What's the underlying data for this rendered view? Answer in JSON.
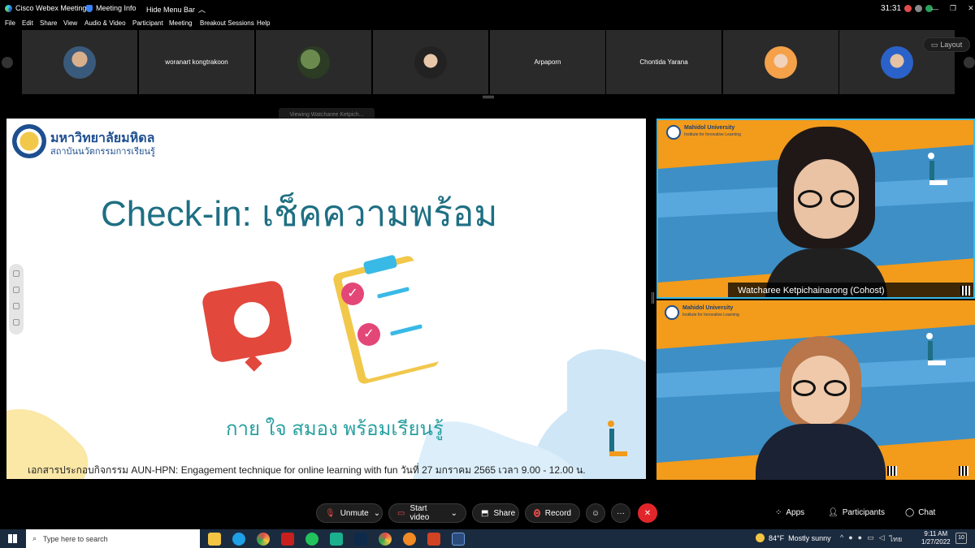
{
  "window": {
    "app_title": "Cisco Webex Meetings",
    "meeting_info": "Meeting Info",
    "hide_menu_bar": "Hide Menu Bar",
    "timer": "31:31"
  },
  "menu": [
    "File",
    "Edit",
    "Share",
    "View",
    "Audio & Video",
    "Participant",
    "Meeting",
    "Breakout Sessions",
    "Help"
  ],
  "participants_strip": [
    {
      "name": "",
      "type": "photo"
    },
    {
      "name": "woranart kongtrakoon",
      "type": "text"
    },
    {
      "name": "",
      "type": "photo"
    },
    {
      "name": "",
      "type": "photo"
    },
    {
      "name": "Arpaporn",
      "type": "text"
    },
    {
      "name": "Chontida Yarana",
      "type": "text"
    },
    {
      "name": "",
      "type": "photo"
    },
    {
      "name": "",
      "type": "photo"
    }
  ],
  "layout_button": "Layout",
  "viewing_label": "Viewing Watcharee Ketpich...",
  "slide": {
    "logo_line1": "มหาวิทยาลัยมหิดล",
    "logo_line2": "สถาบันนวัตกรรมการเรียนรู้",
    "title": "Check-in: เช็คความพร้อม",
    "subtitle": "กาย ใจ สมอง พร้อมเรียนรู้",
    "footer": "เอกสารประกอบกิจกรรม AUN-HPN: Engagement technique for online learning with fun วันที่ 27 มกราคม 2565 เวลา 9.00 - 12.00 น."
  },
  "videos": [
    {
      "name_label": "Watcharee Ketpichainarong (Cohost)",
      "bg_header": "Mahidol University",
      "bg_sub": "Institute for Innovative Learning"
    },
    {
      "name_label": "",
      "bg_header": "Mahidol University",
      "bg_sub": "Institute for Innovative Learning"
    }
  ],
  "toolbar": {
    "unmute": "Unmute",
    "start_video": "Start video",
    "share": "Share",
    "record": "Record",
    "apps": "Apps",
    "participants": "Participants",
    "chat": "Chat"
  },
  "taskbar": {
    "search_placeholder": "Type here to search",
    "weather_temp": "84°F",
    "weather_desc": "Mostly sunny",
    "lang": "ไทย",
    "time": "9:11 AM",
    "date": "1/27/2022",
    "notification_count": "10"
  },
  "colors": {
    "orange_bg": "#f39b1b",
    "active_border": "#39b9e6",
    "slide_title": "#1e5c74",
    "leave_red": "#e0262b"
  }
}
